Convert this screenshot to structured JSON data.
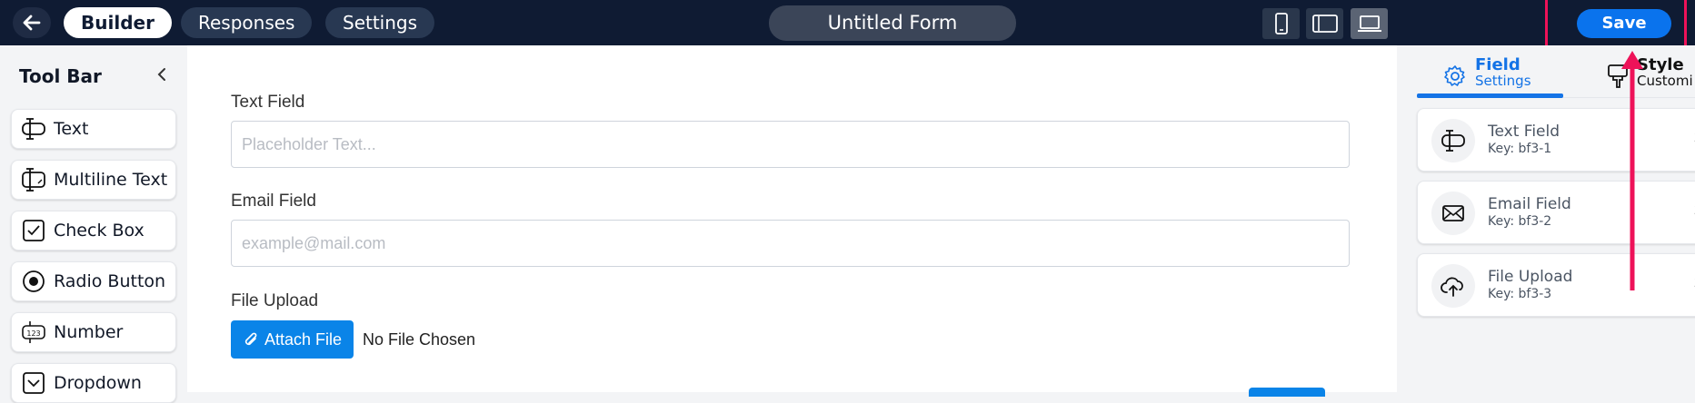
{
  "header": {
    "tabs": [
      {
        "label": "Builder"
      },
      {
        "label": "Responses"
      },
      {
        "label": "Settings"
      }
    ],
    "form_title": "Untitled Form",
    "save_label": "Save"
  },
  "sidebar": {
    "title": "Tool Bar",
    "tools": [
      {
        "label": "Text",
        "icon": "text-cursor-icon"
      },
      {
        "label": "Multiline Text",
        "icon": "multiline-text-icon"
      },
      {
        "label": "Check Box",
        "icon": "checkbox-icon"
      },
      {
        "label": "Radio Button",
        "icon": "radio-icon"
      },
      {
        "label": "Number",
        "icon": "number-123-icon"
      },
      {
        "label": "Dropdown",
        "icon": "dropdown-icon"
      }
    ]
  },
  "canvas": {
    "fields": [
      {
        "label": "Text Field",
        "placeholder": "Placeholder Text..."
      },
      {
        "label": "Email Field",
        "placeholder": "example@mail.com"
      }
    ],
    "file_upload": {
      "label": "File Upload",
      "button_label": "Attach File",
      "status": "No File Chosen"
    }
  },
  "right_panel": {
    "tabs": [
      {
        "title": "Field",
        "subtitle": "Settings"
      },
      {
        "title": "Style",
        "subtitle": "Customi"
      }
    ],
    "fields": [
      {
        "name": "Text Field",
        "key": "Key: bf3-1",
        "icon": "text-cursor-icon"
      },
      {
        "name": "Email Field",
        "key": "Key: bf3-2",
        "icon": "envelope-icon"
      },
      {
        "name": "File Upload",
        "key": "Key: bf3-3",
        "icon": "cloud-upload-icon"
      }
    ],
    "card_marks": [
      "2",
      "2",
      "2"
    ]
  },
  "colors": {
    "header_bg": "#0f1b33",
    "accent": "#0a73ed",
    "annotation": "#ee1259"
  }
}
